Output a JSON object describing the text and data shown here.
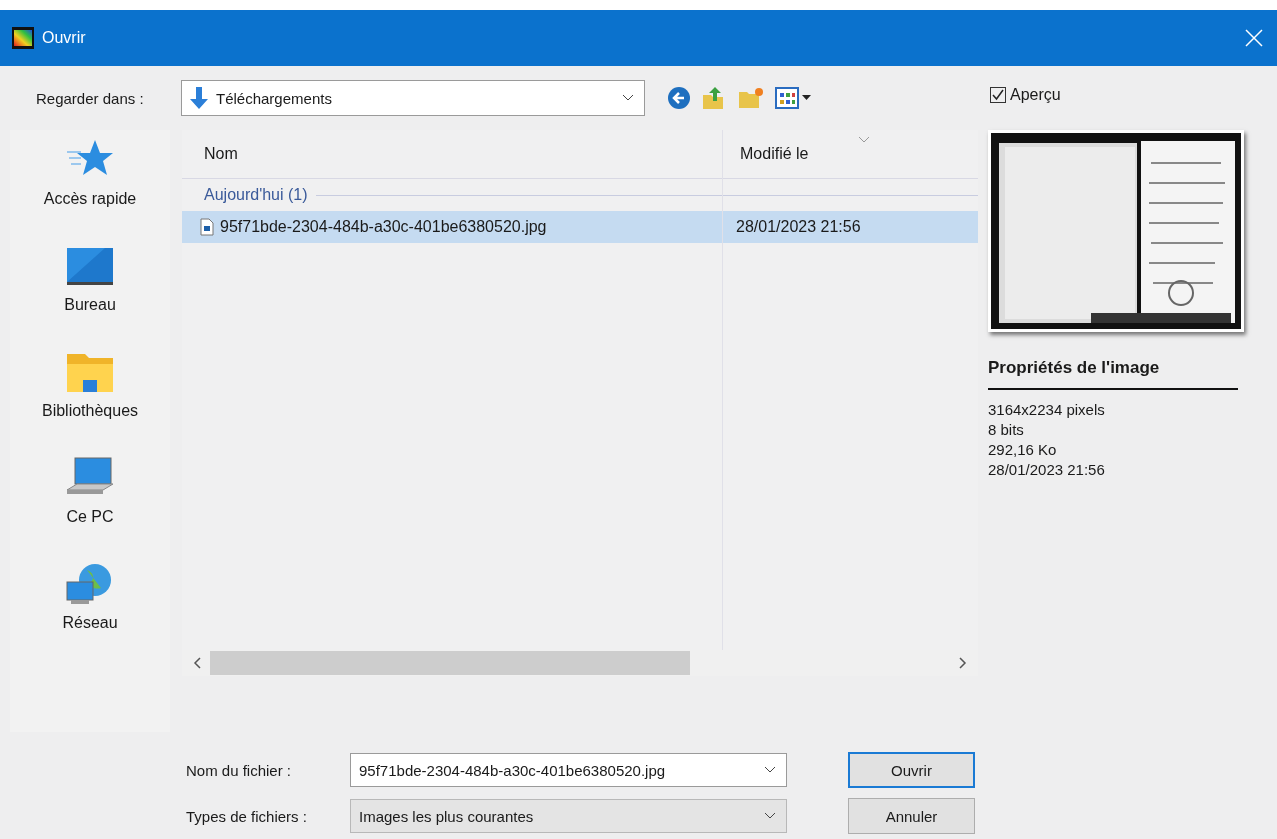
{
  "window": {
    "title": "Ouvrir"
  },
  "toolbar": {
    "look_in_label": "Regarder dans :",
    "look_in_value": "Téléchargements"
  },
  "preview": {
    "label": "Aperçu",
    "checked": true,
    "properties_title": "Propriétés de l'image",
    "properties": [
      "3164x2234 pixels",
      "8 bits",
      "292,16 Ko",
      "28/01/2023 21:56"
    ]
  },
  "sidebar": {
    "items": [
      {
        "label": "Accès rapide",
        "kind": "star"
      },
      {
        "label": "Bureau",
        "kind": "desktop"
      },
      {
        "label": "Bibliothèques",
        "kind": "library"
      },
      {
        "label": "Ce PC",
        "kind": "computer"
      },
      {
        "label": "Réseau",
        "kind": "network"
      }
    ]
  },
  "file_list": {
    "columns": [
      "Nom",
      "Modifié le"
    ],
    "groups": [
      {
        "label": "Aujourd'hui (1)",
        "rows": [
          {
            "name": "95f71bde-2304-484b-a30c-401be6380520.jpg",
            "modified": "28/01/2023 21:56",
            "selected": true
          }
        ]
      }
    ]
  },
  "file_name": {
    "label": "Nom du fichier :",
    "value": "95f71bde-2304-484b-a30c-401be6380520.jpg"
  },
  "file_type": {
    "label": "Types de fichiers :",
    "value": "Images les plus courantes"
  },
  "buttons": [
    {
      "label": "Ouvrir",
      "default": true
    },
    {
      "label": "Annuler",
      "default": false
    }
  ]
}
